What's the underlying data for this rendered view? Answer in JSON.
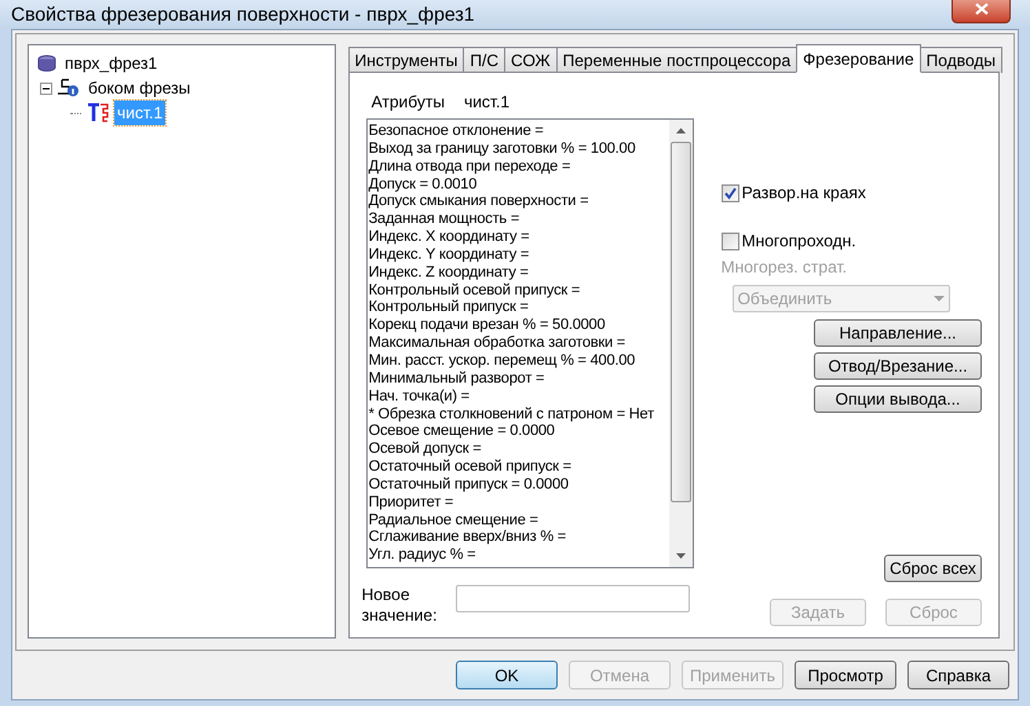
{
  "window": {
    "title": "Свойства фрезерования поверхности - пврх_фрез1"
  },
  "tree": [
    {
      "label": "пврх_фрез1",
      "kind": "database",
      "selected": false,
      "children": [
        {
          "label": "боком фрезы",
          "kind": "operation",
          "selected": false,
          "expanded": true,
          "children": [
            {
              "label": "чист.1",
              "kind": "tool",
              "selected": true
            }
          ]
        }
      ]
    }
  ],
  "tabs": [
    {
      "label": "Инструменты",
      "selected": false
    },
    {
      "label": "П/С",
      "selected": false
    },
    {
      "label": "СОЖ",
      "selected": false
    },
    {
      "label": "Переменные постпроцессора",
      "selected": false
    },
    {
      "label": "Фрезерование",
      "selected": true
    },
    {
      "label": "Подводы",
      "selected": false
    }
  ],
  "attributes": {
    "label": "Атрибуты",
    "value": "чист.1"
  },
  "attribute_list": [
    "Безопасное отклонение =",
    "Выход за границу заготовки % = 100.00",
    "Длина отвода при переходе =",
    "Допуск = 0.0010",
    "Допуск смыкания поверхности =",
    "Заданная мощность =",
    "Индекс. X координату =",
    "Индекс. Y координату =",
    "Индекс. Z координату =",
    "Контрольный осевой припуск =",
    "Контрольный припуск =",
    "Корекц подачи врезан % = 50.0000",
    "Максимальная обработка заготовки =",
    "Мин. расст. ускор. перемещ % = 400.00",
    "Минимальный разворот =",
    "Нач. точка(и) =",
    "* Обрезка столкновений с патроном = Нет",
    "Осевое смещение = 0.0000",
    "Осевой допуск =",
    "Остаточный осевой припуск =",
    "Остаточный припуск = 0.0000",
    "Приоритет =",
    "Радиальное смещение =",
    "Сглаживание вверх/вниз % =",
    "Угл. радиус % ="
  ],
  "new_value": {
    "label": "Новое значение:"
  },
  "checkboxes": [
    {
      "label": "Развор.на краях",
      "checked": true
    },
    {
      "label": "Многопроходн.",
      "checked": false
    }
  ],
  "multipass_strategy": {
    "label": "Многорез. страт.",
    "value": "Объединить",
    "disabled": true
  },
  "action_buttons": [
    "Направление...",
    "Отвод/Врезание...",
    "Опции вывода..."
  ],
  "reset_all": "Сброс всех",
  "value_buttons": [
    {
      "label": "Задать",
      "disabled": true
    },
    {
      "label": "Сброс",
      "disabled": true
    }
  ],
  "dialog_buttons": [
    {
      "label": "OK",
      "disabled": false,
      "default": true
    },
    {
      "label": "Отмена",
      "disabled": true,
      "default": false
    },
    {
      "label": "Применить",
      "disabled": true,
      "default": false
    },
    {
      "label": "Просмотр",
      "disabled": false,
      "default": false
    },
    {
      "label": "Справка",
      "disabled": false,
      "default": false
    }
  ]
}
